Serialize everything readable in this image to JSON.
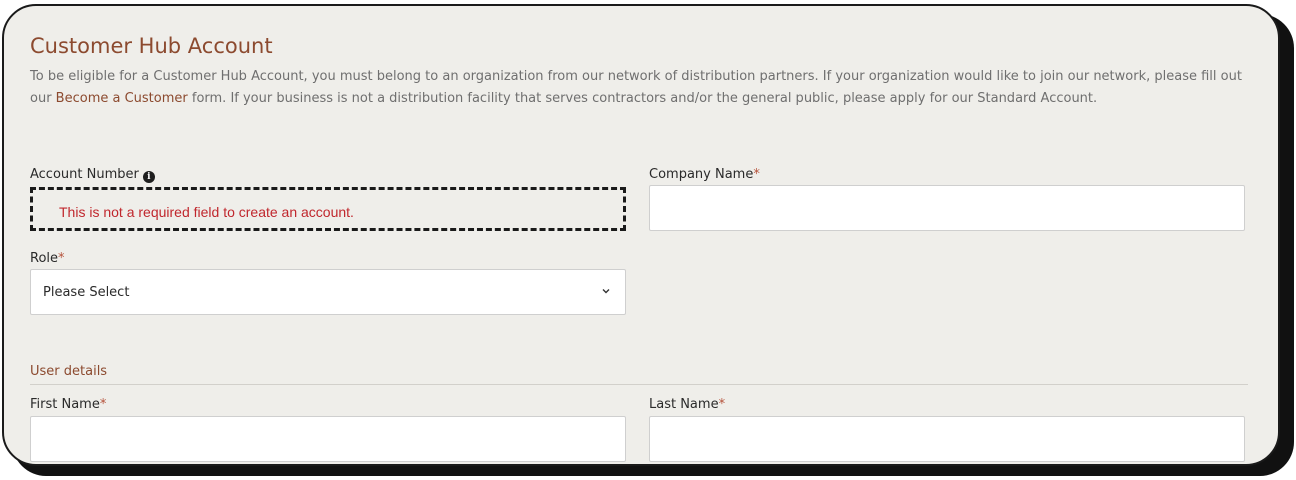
{
  "header": {
    "title": "Customer Hub Account"
  },
  "intro": {
    "text_before": "To be eligible for a Customer Hub Account, you must belong to an organization from our network of distribution partners. If your organization would like to join our network, please fill out our ",
    "link_text": "Become a Customer",
    "text_after": " form. If your business is not a distribution facility that serves contractors and/or the general public, please apply for our Standard Account."
  },
  "fields": {
    "account_number": {
      "label": "Account Number",
      "info_icon": "info-icon",
      "note": "This is not a required field to create an account."
    },
    "company_name": {
      "label": "Company Name",
      "required_mark": "*",
      "value": ""
    },
    "role": {
      "label": "Role",
      "required_mark": "*",
      "selected": "Please Select",
      "icon": "chevron-down-icon"
    },
    "first_name": {
      "label": "First Name",
      "required_mark": "*",
      "value": ""
    },
    "last_name": {
      "label": "Last Name",
      "required_mark": "*",
      "value": ""
    }
  },
  "sections": {
    "user_details": "User details"
  },
  "colors": {
    "brand": "#8c4a2f",
    "required": "#b5523b",
    "note": "#c0272d",
    "background": "#efeeea"
  }
}
